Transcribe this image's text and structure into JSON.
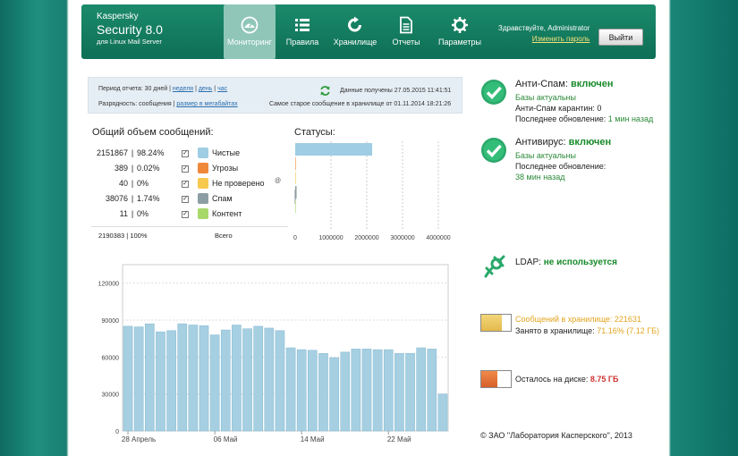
{
  "header": {
    "brand_line1": "Kaspersky",
    "brand_line2": "Security 8.0",
    "brand_line3": "для Linux Mail Server",
    "nav": [
      {
        "label": "Мониторинг",
        "icon": "monitoring-icon",
        "active": true
      },
      {
        "label": "Правила",
        "icon": "rules-icon",
        "active": false
      },
      {
        "label": "Хранилище",
        "icon": "storage-icon",
        "active": false
      },
      {
        "label": "Отчеты",
        "icon": "reports-icon",
        "active": false
      },
      {
        "label": "Параметры",
        "icon": "settings-icon",
        "active": false
      }
    ],
    "greeting": "Здравствуйте, Administrator",
    "change_password": "Изменить пароль",
    "logout": "Выйти"
  },
  "filter": {
    "period_label": "Период отчета: 30 дней |",
    "week": "неделя",
    "day": "день",
    "hour": "час",
    "sep": "|",
    "granularity_label": "Разрядность: сообщения |",
    "megabytes": "размер в мегабайтах",
    "received": "Данные получены 27.05.2015 11:41:51",
    "oldest": "Самое старое сообщение в хранилище от 01.11.2014 18:21:26"
  },
  "volume": {
    "title": "Общий объем сообщений:",
    "rows": [
      {
        "count": "2151867",
        "percent": "98.24%",
        "label": "Чистые",
        "color": "#9ecde4"
      },
      {
        "count": "389",
        "percent": "0.02%",
        "label": "Угрозы",
        "color": "#f0883a"
      },
      {
        "count": "40",
        "percent": "0%",
        "label": "Не проверено",
        "color": "#f7c94f"
      },
      {
        "count": "38076",
        "percent": "1.74%",
        "label": "Спам",
        "color": "#8c9ea3"
      },
      {
        "count": "11",
        "percent": "0%",
        "label": "Контент",
        "color": "#a8d86a"
      }
    ],
    "total": "2190383 | 100%",
    "total_label": "Всего",
    "bar_sep": "|",
    "help": "@"
  },
  "statuses": {
    "title": "Статусы:",
    "ticks": [
      "0",
      "1000000",
      "2000000",
      "3000000",
      "4000000"
    ]
  },
  "chart_data": [
    {
      "type": "bar",
      "title": "Статусы:",
      "orientation": "horizontal",
      "categories": [
        "Чистые",
        "Угрозы",
        "Не проверено",
        "Спам",
        "Контент"
      ],
      "values": [
        2151867,
        389,
        40,
        38076,
        11
      ],
      "xlim": [
        0,
        4000000
      ],
      "x_ticks": [
        "0",
        "1000000",
        "2000000",
        "3000000",
        "4000000"
      ],
      "grid": true
    },
    {
      "type": "bar",
      "ylim": [
        0,
        135000
      ],
      "y_ticks": [
        "0",
        "30000",
        "60000",
        "90000",
        "120000"
      ],
      "x_tick_labels": [
        "28 Апрель",
        "06 Май",
        "14 Май",
        "22 Май"
      ],
      "values": [
        85000,
        84500,
        87000,
        80500,
        81500,
        87000,
        86000,
        85500,
        78000,
        82000,
        86000,
        83000,
        85000,
        83500,
        81500,
        67500,
        66000,
        65500,
        63000,
        59500,
        64000,
        66500,
        66500,
        66000,
        66000,
        63000,
        63000,
        67500,
        66500,
        30000
      ],
      "series_color": "#a6cfe2",
      "grid": true
    }
  ],
  "status": {
    "antispam_title": "Анти-Спам:",
    "antispam_state": "включен",
    "antispam_bases": "Базы актуальны",
    "antispam_quarantine": "Анти-Спам карантин: 0",
    "antispam_update_label": "Последнее обновление:",
    "antispam_update_value": "1 мин назад",
    "antivirus_title": "Антивирус:",
    "antivirus_state": "включен",
    "antivirus_bases": "Базы актуальны",
    "antivirus_update_label": "Последнее обновление:",
    "antivirus_update_value": "38 мин назад",
    "ldap_title": "LDAP:",
    "ldap_state": "не используется",
    "storage_messages": "Сообщений в хранилище: 221631",
    "storage_used_label": "Занято в хранилище:",
    "storage_used_value": "71.16% (7.12 ГБ)",
    "storage_fill": 0.71,
    "disk_left_label": "Осталось на диске:",
    "disk_left_value": "8.75 ГБ",
    "disk_fill": 0.55
  },
  "footer": "© ЗАО \"Лаборатория Касперского\", 2013"
}
